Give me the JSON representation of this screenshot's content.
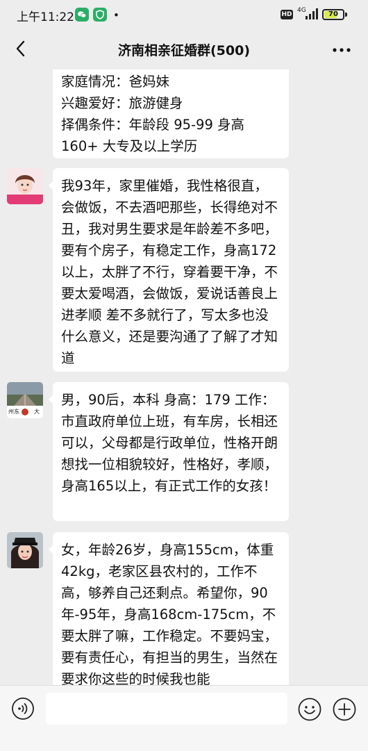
{
  "status_bar": {
    "time": "上午11:22",
    "dot": "•",
    "hd": "HD",
    "network": "4G",
    "battery": "70",
    "battery_level": 0.7
  },
  "header": {
    "title": "济南相亲征婚群(500)"
  },
  "messages": [
    {
      "text": "家庭情况：爸妈妹\n兴趣爱好：旅游健身\n择偶条件：年龄段 95-99 身高 160+ 大专及以上学历"
    },
    {
      "text": "我93年，家里催婚，我性格很直，会做饭，不去酒吧那些，长得绝对不丑，我对男生要求是年龄差不多吧，要有个房子，有稳定工作，身高172以上，太胖了不行，穿着要干净，不要太爱喝酒，会做饭，爱说话善良上进孝顺 差不多就行了，写太多也没什么意义，还是要沟通了了解了才知道"
    },
    {
      "text": "男，90后，本科 身高：179 工作：市直政府单位上班，有车房，长相还可以，父母都是行政单位，性格开朗 想找一位相貌较好，性格好，孝顺，身高165以上，有正式工作的女孩！"
    },
    {
      "text": "女，年龄26岁，身高155cm，体重42kg，老家区县农村的，工作不高，够养自己还剩点。希望你，90年-95年，身高168cm-175cm，不要太胖了嘛，工作稳定。不要妈宝，要有责任心，有担当的男生，当然在要求你这些的时候我也能"
    }
  ],
  "avatar_text": {
    "left": "州东",
    "right": "大"
  },
  "input": {
    "placeholder": ""
  }
}
